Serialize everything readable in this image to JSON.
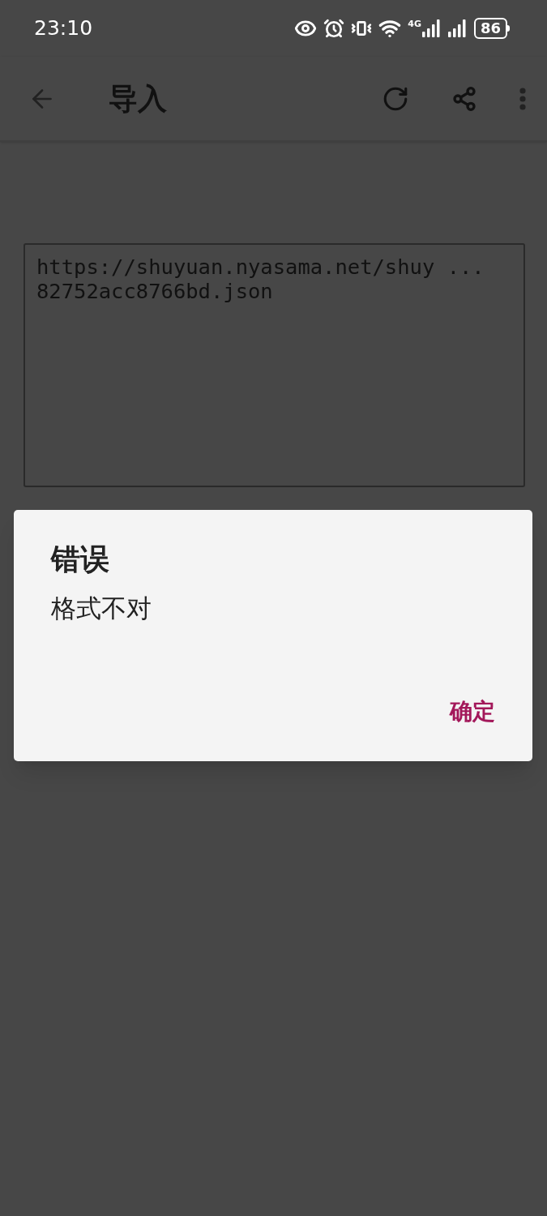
{
  "status_bar": {
    "time": "23:10",
    "network": "4G",
    "battery": "86"
  },
  "app_bar": {
    "title": "导入"
  },
  "source_field": {
    "value": "https://shuyuan.nyasama.net/shuy ... 82752acc8766bd.json"
  },
  "dialog": {
    "title": "错误",
    "message": "格式不对",
    "buttons": [
      "确定"
    ]
  }
}
